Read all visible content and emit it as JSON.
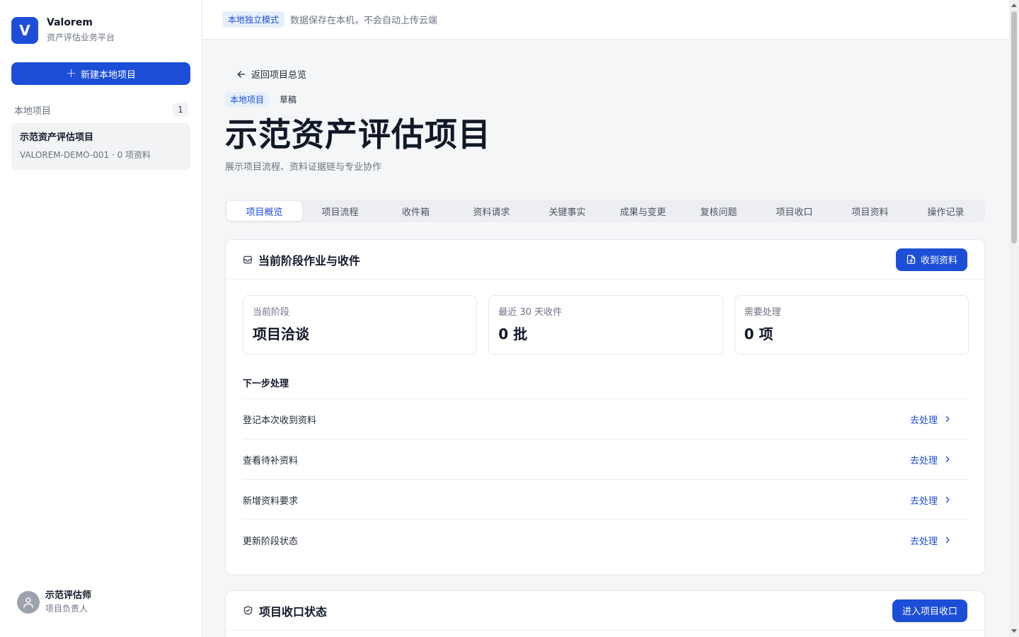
{
  "brand": {
    "logo": "V",
    "name": "Valorem",
    "subtitle": "资产评估业务平台"
  },
  "sidebar": {
    "new_button": "新建本地项目",
    "section_title": "本地项目",
    "count": "1",
    "projects": [
      {
        "name": "示范资产评估项目",
        "meta": "VALOREM-DEMO-001 · 0 项资料"
      }
    ],
    "user": {
      "name": "示范评估师",
      "role": "项目负责人"
    }
  },
  "topbar": {
    "badge": "本地独立模式",
    "text": "数据保存在本机，不会自动上传云端"
  },
  "project": {
    "back": "返回项目总览",
    "tag_local": "本地项目",
    "tag_status": "草稿",
    "title": "示范资产评估项目",
    "subtitle": "展示项目流程、资料证据链与专业协作"
  },
  "tabs": [
    "项目概览",
    "项目流程",
    "收件箱",
    "资料请求",
    "关键事实",
    "成果与变更",
    "复核问题",
    "项目收口",
    "项目资料",
    "操作记录"
  ],
  "stage_card": {
    "title": "当前阶段作业与收件",
    "button": "收到资料",
    "stats": [
      {
        "label": "当前阶段",
        "value": "项目洽谈"
      },
      {
        "label": "最近 30 天收件",
        "value": "0 批"
      },
      {
        "label": "需要处理",
        "value": "0 项"
      }
    ],
    "next_title": "下一步处理",
    "actions": [
      {
        "label": "登记本次收到资料",
        "link": "去处理"
      },
      {
        "label": "查看待补资料",
        "link": "去处理"
      },
      {
        "label": "新增资料要求",
        "link": "去处理"
      },
      {
        "label": "更新阶段状态",
        "link": "去处理"
      }
    ]
  },
  "closing_card": {
    "title": "项目收口状态",
    "button": "进入项目收口"
  },
  "colors": {
    "primary": "#1d4ed8",
    "badge_bg": "#e6f0fb"
  }
}
